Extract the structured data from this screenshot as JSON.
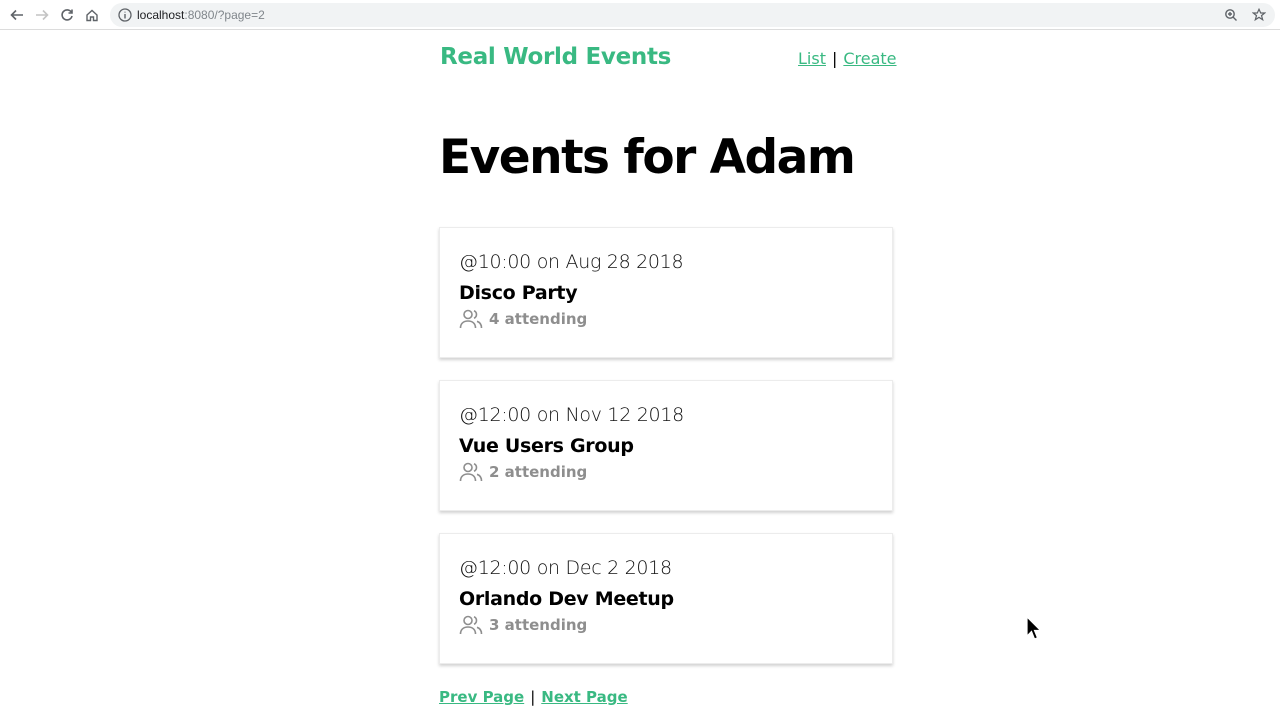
{
  "browser": {
    "url_host": "localhost",
    "url_rest": ":8080/?page=2",
    "icons": [
      "back-arrow-icon",
      "forward-arrow-icon",
      "reload-icon",
      "home-icon",
      "info-icon",
      "zoom-icon",
      "star-icon"
    ]
  },
  "header": {
    "brand": "Real World Events",
    "nav": {
      "list": "List",
      "separator": "|",
      "create": "Create"
    }
  },
  "main": {
    "title": "Events for Adam",
    "events": [
      {
        "time": "@10:00 on Aug 28 2018",
        "title": "Disco Party",
        "attending": "4 attending"
      },
      {
        "time": "@12:00 on Nov 12 2018",
        "title": "Vue Users Group",
        "attending": "2 attending"
      },
      {
        "time": "@12:00 on Dec 2 2018",
        "title": "Orlando Dev Meetup",
        "attending": "3 attending"
      }
    ]
  },
  "pagination": {
    "prev": "Prev Page",
    "separator": "|",
    "next": "Next Page"
  },
  "colors": {
    "accent": "#39b982",
    "muted": "#8e8e8e"
  }
}
